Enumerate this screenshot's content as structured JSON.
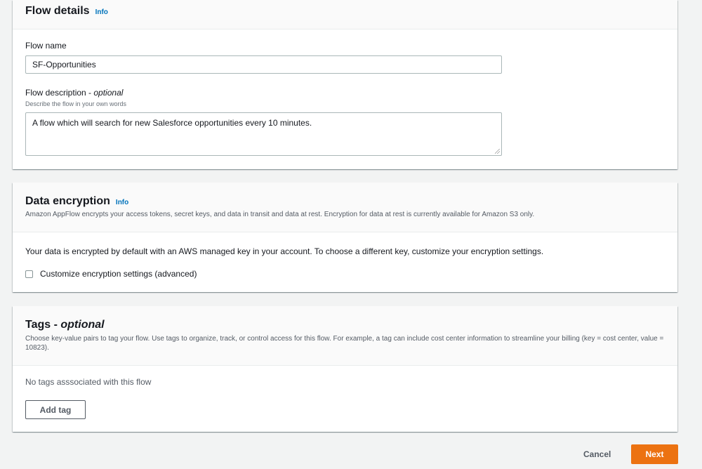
{
  "flow_details": {
    "title": "Flow details",
    "info": "Info",
    "name_label": "Flow name",
    "name_value": "SF-Opportunities",
    "description_label": "Flow description - ",
    "description_optional": "optional",
    "description_hint": "Describe the flow in your own words",
    "description_value": "A flow which will search for new Salesforce opportunities every 10 minutes."
  },
  "data_encryption": {
    "title": "Data encryption",
    "info": "Info",
    "description": "Amazon AppFlow encrypts your access tokens, secret keys, and data in transit and data at rest. Encryption for data at rest is currently available for Amazon S3 only.",
    "body": "Your data is encrypted by default with an AWS managed key in your account. To choose a different key, customize your encryption settings.",
    "checkbox_label": "Customize encryption settings (advanced)"
  },
  "tags": {
    "title": "Tags - ",
    "title_optional": "optional",
    "description": "Choose key-value pairs to tag your flow. Use tags to organize, track, or control access for this flow. For example, a tag can include cost center information to streamline your billing (key = cost center, value = 10823).",
    "empty_text": "No tags asssociated with this flow",
    "add_button": "Add tag"
  },
  "footer": {
    "cancel": "Cancel",
    "next": "Next"
  },
  "colors": {
    "primary": "#ec7211",
    "link": "#0073bb",
    "background": "#f2f3f3"
  }
}
